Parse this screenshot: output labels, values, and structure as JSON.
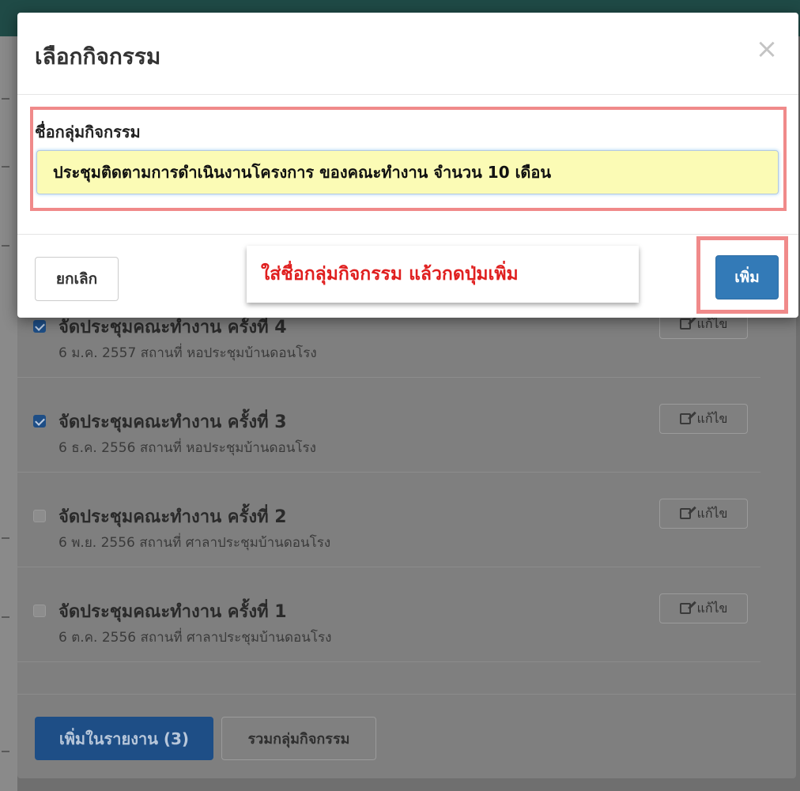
{
  "modal": {
    "title": "เลือกกิจกรรม",
    "close_glyph": "×",
    "field_label": "ชื่อกลุ่มกิจกรรม",
    "field_value": "ประชุมติดตามการดำเนินงานโครงการ ของคณะทำงาน จำนวน 10 เดือน",
    "cancel_label": "ยกเลิก",
    "add_label": "เพิ่ม",
    "hint_text": "ใส่ชื่อกลุ่มกิจกรรม แล้วกดปุ่มเพิ่ม"
  },
  "activities": [
    {
      "title": "จัดประชุมคณะทำงาน ครั้งที่ 4",
      "detail": "6 ม.ค. 2557 สถานที่ หอประชุมบ้านดอนโรง",
      "checked": true,
      "edit_label": "แก้ไข"
    },
    {
      "title": "จัดประชุมคณะทำงาน ครั้งที่ 3",
      "detail": "6 ธ.ค. 2556 สถานที่ หอประชุมบ้านดอนโรง",
      "checked": true,
      "edit_label": "แก้ไข"
    },
    {
      "title": "จัดประชุมคณะทำงาน ครั้งที่ 2",
      "detail": "6 พ.ย. 2556 สถานที่ ศาลาประชุมบ้านดอนโรง",
      "checked": false,
      "edit_label": "แก้ไข"
    },
    {
      "title": "จัดประชุมคณะทำงาน ครั้งที่ 1",
      "detail": "6 ต.ค. 2556 สถานที่ ศาลาประชุมบ้านดอนโรง",
      "checked": false,
      "edit_label": "แก้ไข"
    }
  ],
  "footer": {
    "add_to_report_label": "เพิ่มในรายงาน (3)",
    "merge_group_label": "รวมกลุ่มกิจกรรม"
  },
  "colors": {
    "primary": "#337ab7",
    "highlight": "#f08a8a",
    "hint_text": "#e01f1f",
    "input_bg": "#fbfbb5"
  }
}
